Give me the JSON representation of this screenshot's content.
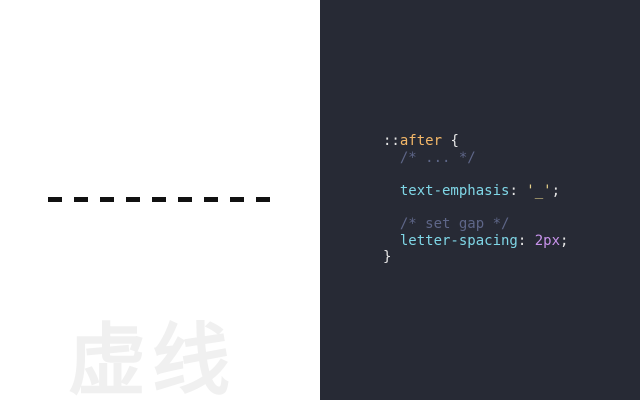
{
  "watermark": "虚线",
  "dash_count": 9,
  "colors": {
    "left_bg": "#ffffff",
    "dash": "#111111",
    "watermark": "#f0f0f0",
    "code_bg": "#272a35",
    "selector": "#f3b768",
    "comment": "#5e6688",
    "property": "#7fd6e6",
    "string": "#e8d28a",
    "number": "#c792ea",
    "punctuation": "#e6e6e6"
  },
  "code": {
    "prefix": "::",
    "selector": "after",
    "open_brace": " {",
    "comment1": "/* ... */",
    "prop1": "text-emphasis",
    "colon1": ": ",
    "value1": "'_'",
    "semi1": ";",
    "comment2": "/* set gap */",
    "prop2": "letter-spacing",
    "colon2": ": ",
    "value2": "2px",
    "semi2": ";",
    "close_brace": "}"
  }
}
